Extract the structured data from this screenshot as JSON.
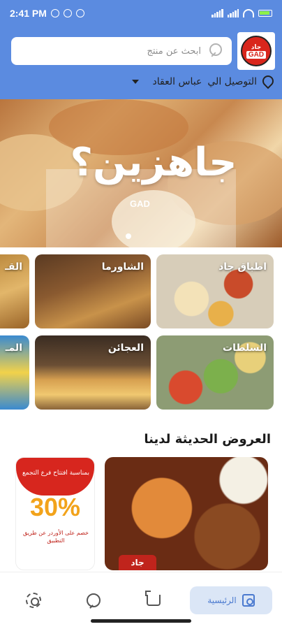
{
  "status_bar": {
    "time": "2:41 PM",
    "colors": {
      "background": "#5b8be0"
    }
  },
  "header": {
    "logo_text_ar": "جاد",
    "logo_text_en": "GAD",
    "search_placeholder": "ابحث عن منتج",
    "delivery_label": "التوصيل الي",
    "delivery_area": "عباس العقاد"
  },
  "banner": {
    "title": "جاهزين؟",
    "logo": "GAD"
  },
  "categories": [
    {
      "label": "اطباق جاد"
    },
    {
      "label": "الشاورما"
    },
    {
      "label": "القـ"
    },
    {
      "label": "السلطات"
    },
    {
      "label": "العجائن"
    },
    {
      "label": "المـ"
    }
  ],
  "offers": {
    "title": "العروض الحديثة لدينا",
    "items": [
      {
        "tag": "جاد"
      },
      {
        "headline": "بمناسبة افتتاح فرع التجمع",
        "discount": "30%",
        "note": "خصم على الأوردر عن طريق التطبيق"
      }
    ]
  },
  "bottom_nav": {
    "home_label": "الرئيسية",
    "icons": [
      "home-icon",
      "cart-icon",
      "search-icon",
      "gear-icon"
    ],
    "active_color": "#4a79cf"
  }
}
